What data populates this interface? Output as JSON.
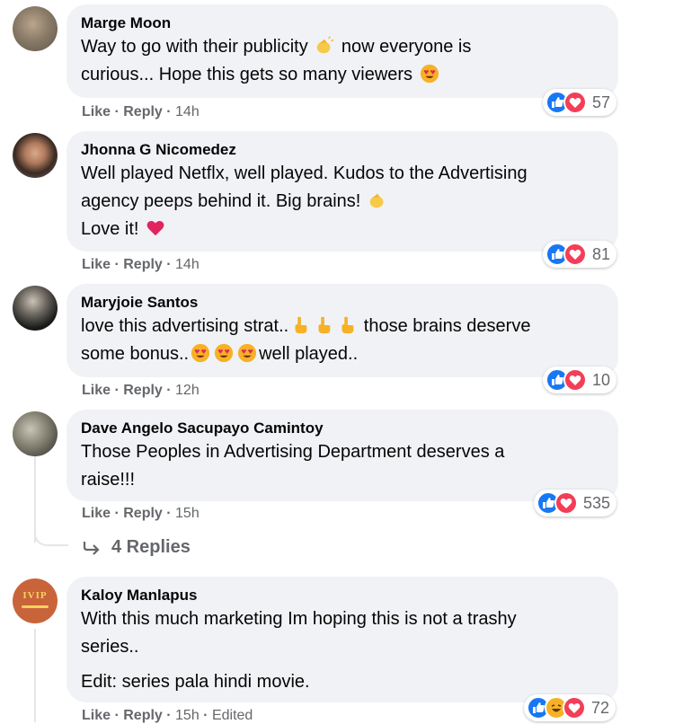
{
  "comments": [
    {
      "author": "Marge Moon",
      "lines": [
        "Way to go with their publicity",
        "now everyone is",
        "curious... Hope this gets so many viewers"
      ],
      "like_label": "Like",
      "reply_label": "Reply",
      "time": "14h",
      "reaction_count": "57",
      "reactions": [
        "like-icon",
        "love-icon"
      ]
    },
    {
      "author": "Jhonna G Nicomedez",
      "line1": "Well played Netflx, well played. Kudos to the Advertising",
      "line2": "agency peeps behind it. Big brains!",
      "line3": "Love it!",
      "like_label": "Like",
      "reply_label": "Reply",
      "time": "14h",
      "reaction_count": "81",
      "reactions": [
        "like-icon",
        "love-icon"
      ]
    },
    {
      "author": "Maryjoie Santos",
      "line1a": "love this advertising strat..",
      "line1b": "those brains deserve",
      "line2a": "some bonus..",
      "line2b": "well played..",
      "like_label": "Like",
      "reply_label": "Reply",
      "time": "12h",
      "reaction_count": "10",
      "reactions": [
        "like-icon",
        "love-icon"
      ]
    },
    {
      "author": "Dave Angelo Sacupayo Camintoy",
      "line1": "Those Peoples in Advertising Department deserves a",
      "line2": "raise!!!",
      "like_label": "Like",
      "reply_label": "Reply",
      "time": "15h",
      "reaction_count": "535",
      "reactions": [
        "like-icon",
        "love-icon"
      ],
      "replies_label": "4 Replies"
    },
    {
      "author": "Kaloy Manlapus",
      "line1": "With this much marketing Im hoping this is not a trashy",
      "line2": "series..",
      "line3": "Edit: series pala hindi movie.",
      "like_label": "Like",
      "reply_label": "Reply",
      "time": "15h",
      "edited_label": "Edited",
      "reaction_count": "72",
      "reactions": [
        "like-icon",
        "haha-icon",
        "love-icon"
      ],
      "avatar_text": "IVIP"
    }
  ],
  "colors": {
    "bubble": "#f0f2f5",
    "like": "#1877f2",
    "love": "#f33e58",
    "meta": "#65676b"
  }
}
